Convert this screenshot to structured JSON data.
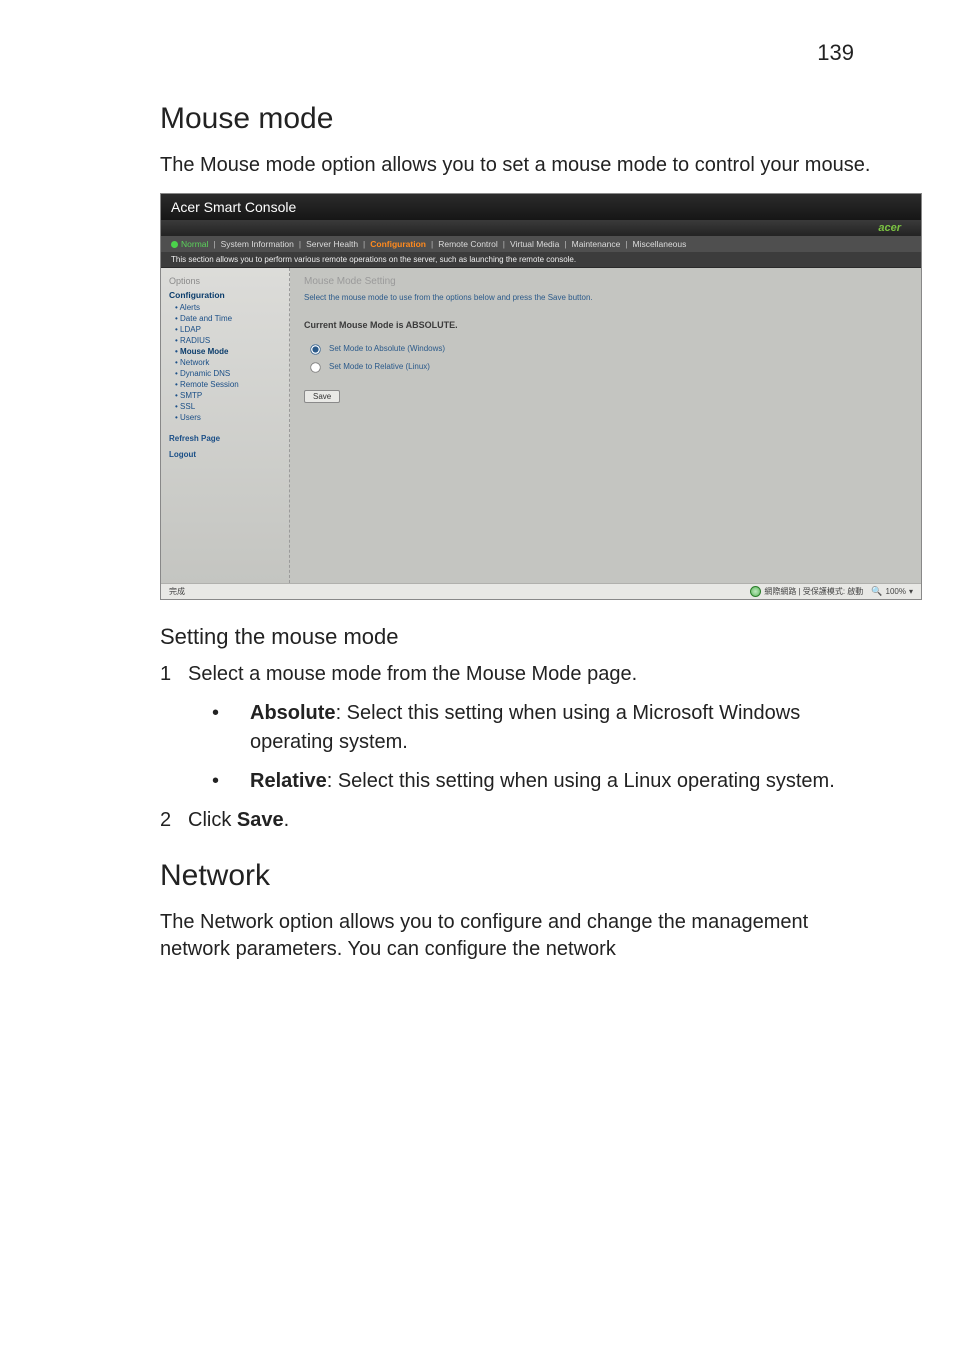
{
  "page_number": "139",
  "section1": {
    "title": "Mouse mode",
    "intro": "The Mouse mode option allows you to set a mouse mode to control your mouse."
  },
  "screenshot": {
    "window_title": "Acer Smart Console",
    "brand": "acer",
    "status_label": "Normal",
    "tabs": {
      "t1": "System Information",
      "t2": "Server Health",
      "t3": "Configuration",
      "t4": "Remote Control",
      "t5": "Virtual Media",
      "t6": "Maintenance",
      "t7": "Miscellaneous"
    },
    "info_bar": "This section allows you to perform various remote operations on the server, such as launching the remote console.",
    "sidebar": {
      "group": "Options",
      "header": "Configuration",
      "items": {
        "i0": "Alerts",
        "i1": "Date and Time",
        "i2": "LDAP",
        "i3": "RADIUS",
        "i4": "Mouse Mode",
        "i5": "Network",
        "i6": "Dynamic DNS",
        "i7": "Remote Session",
        "i8": "SMTP",
        "i9": "SSL",
        "i10": "Users"
      },
      "refresh": "Refresh Page",
      "logout": "Logout"
    },
    "main": {
      "panel_title": "Mouse Mode Setting",
      "desc": "Select the mouse mode to use from the options below and press the Save button.",
      "state": "Current Mouse Mode is ABSOLUTE.",
      "opt1": "Set Mode to Absolute (Windows)",
      "opt2": "Set Mode to Relative (Linux)",
      "save": "Save"
    },
    "statusbar": {
      "left": "完成",
      "zone": "網際網路 | 受保護模式: 啟動",
      "zoom": "100%"
    }
  },
  "subsection": {
    "title": "Setting the mouse mode",
    "step1_marker": "1",
    "step1_text": "Select a mouse mode from the Mouse Mode page.",
    "bullet1_label": "Absolute",
    "bullet1_rest": ": Select this setting when using a Microsoft Windows operating system.",
    "bullet2_label": "Relative",
    "bullet2_rest": ": Select this setting when using a Linux operating system.",
    "step2_marker": "2",
    "step2_prefix": "Click ",
    "step2_action": "Save",
    "step2_suffix": "."
  },
  "section2": {
    "title": "Network",
    "intro": "The Network option allows you to configure and change the management network parameters. You can configure the network"
  }
}
